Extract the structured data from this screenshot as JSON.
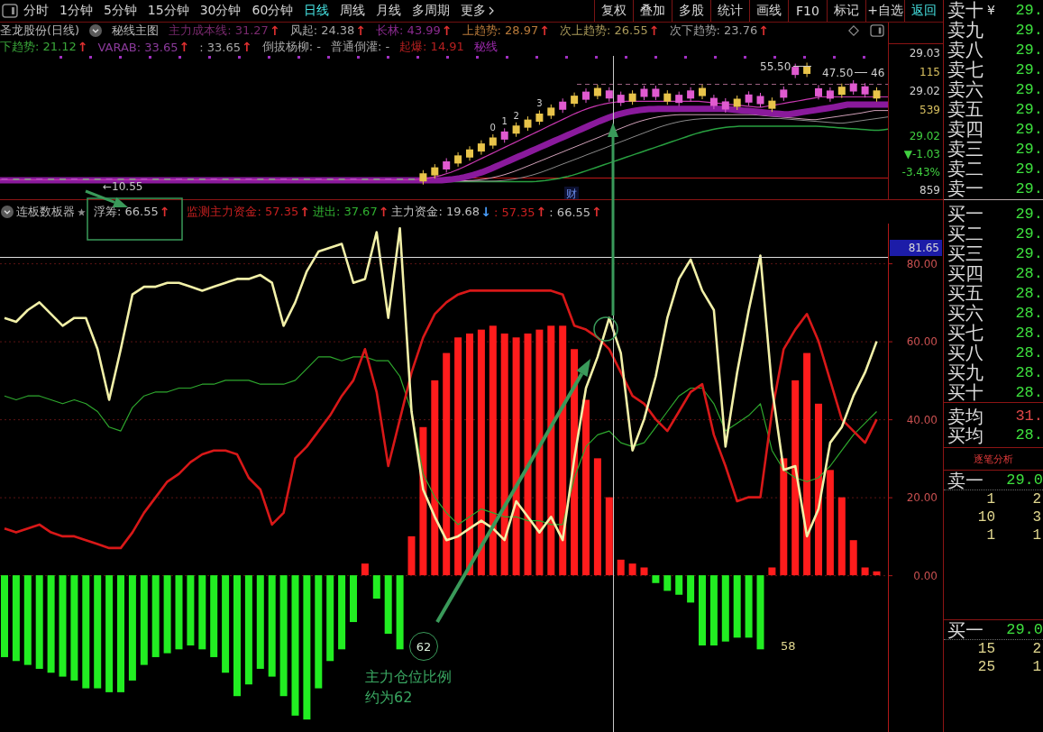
{
  "toolbar": {
    "tabs": [
      {
        "label": "分时",
        "kind": "period",
        "selected": false
      },
      {
        "label": "1分钟",
        "kind": "period",
        "selected": false
      },
      {
        "label": "5分钟",
        "kind": "period",
        "selected": false
      },
      {
        "label": "15分钟",
        "kind": "period",
        "selected": false
      },
      {
        "label": "30分钟",
        "kind": "period",
        "selected": false
      },
      {
        "label": "60分钟",
        "kind": "period",
        "selected": false
      },
      {
        "label": "日线",
        "kind": "period",
        "selected": true
      },
      {
        "label": "周线",
        "kind": "period",
        "selected": false
      },
      {
        "label": "月线",
        "kind": "period",
        "selected": false
      },
      {
        "label": "多周期",
        "kind": "period",
        "selected": false
      },
      {
        "label": "更多",
        "kind": "menu",
        "selected": false
      }
    ],
    "buttons": [
      {
        "label": "复权",
        "kind": "command"
      },
      {
        "label": "叠加",
        "kind": "command"
      },
      {
        "label": "多股",
        "kind": "command"
      },
      {
        "label": "统计",
        "kind": "command"
      },
      {
        "label": "画线",
        "kind": "command"
      },
      {
        "label": "F10",
        "kind": "command"
      },
      {
        "label": "标记",
        "kind": "command"
      },
      {
        "label": "+自选",
        "kind": "command"
      },
      {
        "label": "返回",
        "kind": "nav"
      }
    ]
  },
  "main_chart": {
    "title": "圣龙股份(日线)",
    "template": "秘线主图",
    "legend_rows": [
      {
        "items": [
          {
            "text": "主力成本线: 31.27",
            "color": "#7a2a6e",
            "arrow": {
              "text": "↑",
              "color": "#e03030"
            }
          },
          {
            "text": "风起: 24.38",
            "color": "#a8a8a8",
            "arrow": {
              "text": "↑",
              "color": "#e03030"
            }
          },
          {
            "text": "长林: 43.99",
            "color": "#8a2a8e",
            "arrow": {
              "text": "↑",
              "color": "#e03030"
            }
          },
          {
            "text": "上趋势: 28.97",
            "color": "#b87a3a",
            "arrow": {
              "text": "↑",
              "color": "#e03030"
            }
          },
          {
            "text": "次上趋势: 26.55",
            "color": "#aa9a5a",
            "arrow": {
              "text": "↑",
              "color": "#e03030"
            }
          },
          {
            "text": "次下趋势: 23.76",
            "color": "#a0a0a0",
            "arrow": {
              "text": "↑",
              "color": "#e03030"
            }
          }
        ]
      },
      {
        "items": [
          {
            "text": "下趋势: 21.12",
            "color": "#3aa83a",
            "arrow": {
              "text": "↑",
              "color": "#e03030"
            }
          },
          {
            "text": "VARAB: 33.65",
            "color": "#8a3a9a",
            "arrow": {
              "text": "↑",
              "color": "#e03030"
            }
          },
          {
            "text": ": 33.65",
            "color": "#a8a8a8",
            "arrow": {
              "text": "↑",
              "color": "#e03030"
            }
          },
          {
            "text": "倒拔杨柳: -",
            "color": "#a8a8a8"
          },
          {
            "text": "普通倒灌: -",
            "color": "#a8a8a8"
          },
          {
            "text": "起爆: 14.91",
            "color": "#b82020"
          },
          {
            "text": "秘线",
            "color": "#9a2aaa"
          }
        ]
      }
    ],
    "chart_labels": {
      "price_marks": [
        "55.50",
        "47.50",
        "46"
      ],
      "low_mark": "←10.55",
      "candle_marks": [
        "0",
        "1",
        "2",
        "3"
      ],
      "event_badge": "财"
    },
    "readout_groups": [
      {
        "items": [
          {
            "text": "29.03",
            "color": "#d0d0d0"
          },
          {
            "text": "115",
            "color": "#d8c060"
          },
          {
            "text": "29.02",
            "color": "#d0d0d0"
          },
          {
            "text": "539",
            "color": "#d8c060"
          }
        ]
      },
      {
        "items": [
          {
            "text": "29.02",
            "color": "#40d040"
          },
          {
            "text": "▼-1.03",
            "color": "#40d040"
          },
          {
            "text": "-3.43%",
            "color": "#40d040"
          },
          {
            "text": "859",
            "color": "#d0d0d0"
          }
        ]
      }
    ]
  },
  "indicator": {
    "title": "连板数板器",
    "legend": [
      {
        "text": "浮筹: 66.55",
        "color": "#c0c0c0",
        "arrow": {
          "text": "↑",
          "color": "#e03030"
        }
      },
      {
        "text": "监测主力资金: 57.35",
        "color": "#c82020",
        "arrow": {
          "text": "↑",
          "color": "#e03030"
        }
      },
      {
        "text": "进出: 37.67",
        "color": "#30b030",
        "arrow": {
          "text": "↑",
          "color": "#e03030"
        }
      },
      {
        "text": "主力资金: 19.68",
        "color": "#c0c0c0",
        "arrow": {
          "text": "↓",
          "color": "#4aa0ff"
        }
      },
      {
        "text": ": 57.35",
        "color": "#c82020",
        "arrow": {
          "text": "↑",
          "color": "#e03030"
        }
      },
      {
        "text": ": 66.55",
        "color": "#c0c0c0",
        "arrow": {
          "text": "↑",
          "color": "#e03030"
        }
      }
    ],
    "crosshair_value": "81.65",
    "chart_data": {
      "type": "line",
      "ylim": [
        -40.2,
        90.2
      ],
      "yticks": [
        {
          "value": 80,
          "label": "80.00"
        },
        {
          "value": 60,
          "label": "60.00"
        },
        {
          "value": 40,
          "label": "40.00"
        },
        {
          "value": 20,
          "label": "20.00"
        },
        {
          "value": 0,
          "label": "0.00"
        }
      ],
      "grid": true,
      "series": [
        {
          "type": "bar",
          "color": "#ff1c1c",
          "values": [
            null,
            null,
            null,
            null,
            null,
            null,
            null,
            null,
            null,
            null,
            null,
            null,
            null,
            null,
            null,
            null,
            null,
            null,
            null,
            null,
            null,
            null,
            null,
            null,
            null,
            null,
            null,
            null,
            null,
            null,
            null,
            3,
            null,
            null,
            null,
            10,
            38,
            50,
            57,
            61,
            62,
            63,
            64,
            62,
            61,
            62,
            63,
            64,
            64,
            58,
            45,
            30,
            20,
            4,
            3,
            2,
            null,
            null,
            null,
            null,
            null,
            null,
            null,
            null,
            null,
            null,
            2,
            30,
            50,
            57,
            44,
            27,
            20,
            9,
            2,
            1
          ]
        },
        {
          "type": "bar",
          "color": "#22ee22",
          "values": [
            -21,
            -22,
            -23,
            -24,
            -25,
            -26,
            -27,
            -29,
            -29,
            -30,
            -30,
            -27,
            -23,
            -21,
            -20,
            -19,
            -18,
            -19,
            -21,
            -25,
            -31,
            -28,
            -24,
            -26,
            -31,
            -36,
            -37,
            -29,
            -22,
            -19,
            -12,
            null,
            -6,
            -15,
            -19,
            null,
            null,
            null,
            null,
            null,
            null,
            null,
            null,
            null,
            null,
            null,
            null,
            null,
            null,
            null,
            null,
            null,
            null,
            null,
            null,
            null,
            -2,
            -4,
            -5,
            -7,
            -18,
            -18,
            -17,
            -16,
            -16,
            -19,
            null,
            null,
            null,
            null,
            null,
            null,
            null,
            null,
            null,
            null
          ]
        },
        {
          "color": "#2ea82e",
          "values": [
            46,
            45,
            46,
            46,
            45,
            44,
            45,
            44,
            42,
            38,
            37,
            43,
            46,
            47,
            47,
            48,
            48,
            49,
            49,
            50,
            50,
            50,
            49,
            49,
            49,
            50,
            53,
            56,
            56,
            55,
            56,
            56,
            55,
            55,
            51,
            42,
            26,
            20,
            16,
            13,
            15,
            17,
            16,
            15,
            15,
            14,
            14,
            13,
            13,
            25,
            33,
            36,
            37,
            34,
            33,
            34,
            38,
            42,
            46,
            48,
            48,
            44,
            37,
            39,
            41,
            44,
            32,
            27,
            25,
            24,
            25,
            28,
            32,
            36,
            39,
            42
          ]
        },
        {
          "color": "#d81818",
          "values": [
            12,
            11,
            12,
            13,
            11,
            10,
            10,
            9,
            8,
            7,
            7,
            11,
            16,
            20,
            24,
            26,
            29,
            31,
            32,
            32,
            31,
            25,
            22,
            13,
            16,
            30,
            33,
            37,
            41,
            46,
            50,
            58,
            47,
            28,
            40,
            52,
            61,
            67,
            70,
            72,
            73,
            73,
            73,
            73,
            73,
            73,
            73,
            73,
            72,
            64,
            63,
            61,
            58,
            52,
            46,
            44,
            40,
            37,
            42,
            47,
            49,
            36,
            28,
            19,
            20,
            20,
            42,
            58,
            63,
            67,
            60,
            50,
            40,
            37,
            34,
            40
          ]
        },
        {
          "color": "#f2f0a8",
          "values": [
            66,
            65,
            68,
            70,
            67,
            64,
            66,
            66,
            58,
            45,
            58,
            72,
            74,
            74,
            75,
            75,
            74,
            73,
            74,
            75,
            76,
            76,
            77,
            75,
            64,
            70,
            78,
            83,
            84,
            85,
            75,
            76,
            88,
            66,
            89,
            42,
            22,
            15,
            9,
            10,
            12,
            14,
            12,
            9,
            19,
            15,
            11,
            15,
            9,
            30,
            48,
            56,
            66,
            57,
            32,
            40,
            51,
            66,
            76,
            81,
            73,
            68,
            33,
            52,
            68,
            82,
            48,
            27,
            28,
            10,
            17,
            34,
            38,
            46,
            52,
            60
          ]
        }
      ]
    }
  },
  "annotations": {
    "circled_number": "62",
    "note_lines": [
      "主力仓位比例",
      "约为62"
    ],
    "marker_value": "58"
  },
  "order_book": {
    "asks": [
      {
        "label": "卖十",
        "unit": "¥",
        "price": "29."
      },
      {
        "label": "卖九",
        "price": "29."
      },
      {
        "label": "卖八",
        "price": "29."
      },
      {
        "label": "卖七",
        "price": "29."
      },
      {
        "label": "卖六",
        "price": "29."
      },
      {
        "label": "卖五",
        "price": "29."
      },
      {
        "label": "卖四",
        "price": "29."
      },
      {
        "label": "卖三",
        "price": "29."
      },
      {
        "label": "卖二",
        "price": "29."
      },
      {
        "label": "卖一",
        "price": "29."
      }
    ],
    "bids": [
      {
        "label": "买一",
        "price": "29."
      },
      {
        "label": "买二",
        "price": "29."
      },
      {
        "label": "买三",
        "price": "29."
      },
      {
        "label": "买四",
        "price": "28."
      },
      {
        "label": "买五",
        "price": "28."
      },
      {
        "label": "买六",
        "price": "28."
      },
      {
        "label": "买七",
        "price": "28."
      },
      {
        "label": "买八",
        "price": "28."
      },
      {
        "label": "买九",
        "price": "28."
      },
      {
        "label": "买十",
        "price": "28."
      }
    ],
    "averages": [
      {
        "label": "卖均",
        "price": "31.",
        "color": "#e04848"
      },
      {
        "label": "买均",
        "price": "28.",
        "color": "#3ee03e"
      }
    ]
  },
  "tick_analysis": {
    "title": "逐笔分析",
    "sections": [
      {
        "label": "卖一",
        "price": "29.0",
        "rows": [
          [
            "1",
            "2"
          ],
          [
            "10",
            "3"
          ],
          [
            "1",
            "1"
          ]
        ]
      },
      {
        "label": "买一",
        "price": "29.0",
        "rows": [
          [
            "15",
            "2"
          ],
          [
            "25",
            "1"
          ]
        ]
      }
    ]
  }
}
